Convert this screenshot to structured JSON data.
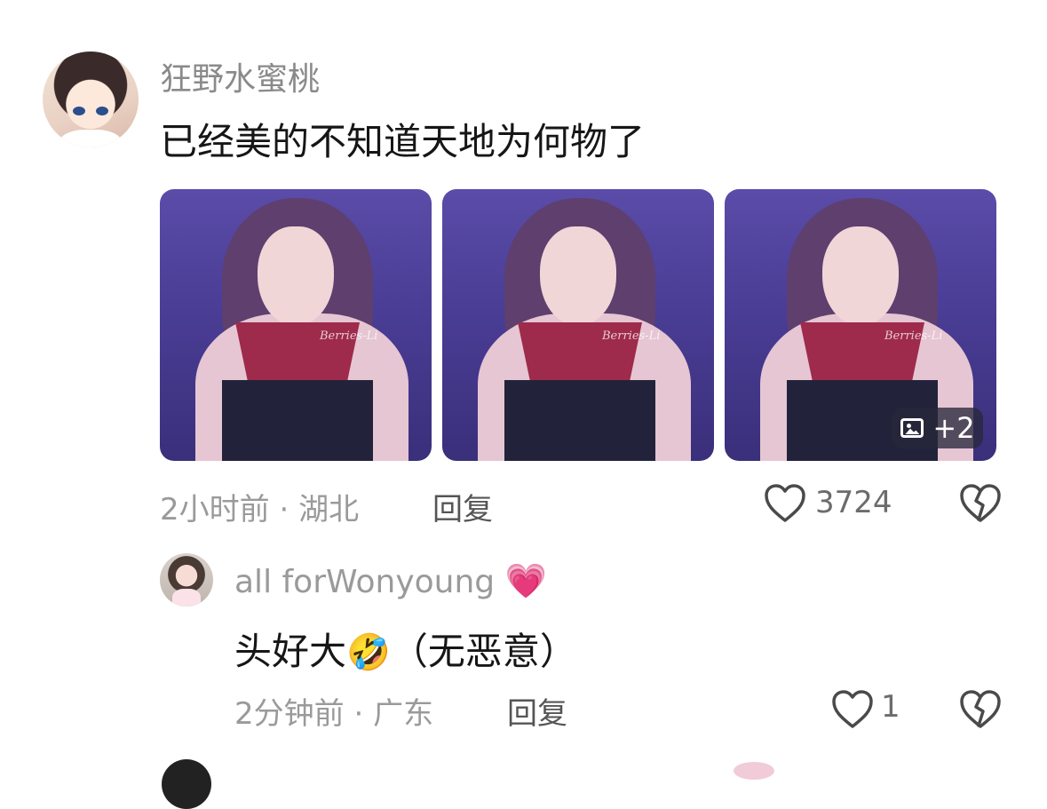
{
  "main_comment": {
    "username": "狂野水蜜桃",
    "text": "已经美的不知道天地为何物了",
    "photos": [
      {
        "watermark": "Berries-Li"
      },
      {
        "watermark": "Berries-Li"
      },
      {
        "watermark": "Berries-Li"
      }
    ],
    "more_images_label": "+2",
    "time": "2小时前",
    "separator": "·",
    "location": "湖北",
    "reply_label": "回复",
    "like_count": "3724"
  },
  "reply_comment": {
    "username": "all forWonyoung",
    "username_emoji": "💗",
    "text_before": "头好大",
    "text_emoji": "🤣",
    "text_after": "（无恶意）",
    "time": "2分钟前",
    "separator": "·",
    "location": "广东",
    "reply_label": "回复",
    "like_count": "1"
  },
  "colors": {
    "text_primary": "#161616",
    "text_secondary": "#9a9a9a",
    "icon_stroke": "#4a4a4a"
  },
  "icons": {
    "like": "heart-outline-icon",
    "dislike": "broken-heart-outline-icon",
    "more_images": "image-icon"
  }
}
